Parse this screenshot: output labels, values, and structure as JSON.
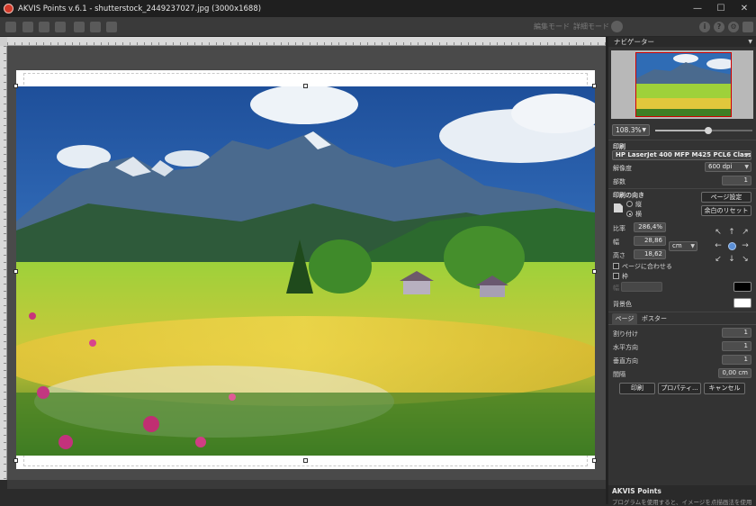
{
  "window": {
    "title": "AKVIS Points v.6.1 - shutterstock_2449237027.jpg (3000x1688)",
    "minimize": "—",
    "maximize": "☐",
    "close": "✕"
  },
  "toolbar": {
    "mode_edit": "編集モード",
    "mode_detail": "詳細モード",
    "icons": [
      "open-icon",
      "save-icon",
      "publish-icon",
      "print-icon",
      "before-icon",
      "after-icon",
      "share-icon",
      "info-icon",
      "help-icon",
      "settings-icon",
      "news-icon"
    ]
  },
  "navigator": {
    "header": "ナビゲーター",
    "zoom": "108.3%",
    "zoom_level": 0.55
  },
  "print": {
    "section_title": "印刷",
    "printer": "HP LaserJet 400 MFP M425 PCL6 Class D...",
    "resolution_label": "解像度",
    "resolution_value": "600 dpi",
    "copies_label": "部数",
    "copies_value": "1",
    "orientation_label": "印刷の向き",
    "portrait_label": "縦",
    "landscape_label": "横",
    "page_setup_button": "ページ設定",
    "reset_margins_button": "余白のリセット",
    "ratio_label": "比率",
    "ratio_value": "286,4%",
    "width_label": "幅",
    "width_value": "28,86",
    "height_label": "高さ",
    "height_value": "18,62",
    "unit_value": "cm",
    "fit_to_page_label": "ページに合わせる",
    "frame_label": "枠",
    "frame_width_label": "幅",
    "frame_color": "#000000",
    "background_label": "背景色",
    "background_color": "#ffffff"
  },
  "tabs": {
    "page": "ページ",
    "poster": "ポスター"
  },
  "poster": {
    "pages_label": "割り付け",
    "pages_value": "1",
    "horizontal_label": "水平方向",
    "horizontal_value": "1",
    "vertical_label": "垂直方向",
    "vertical_value": "1",
    "spacing_label": "間隔",
    "spacing_value": "0,00 cm"
  },
  "actions": {
    "print_button": "印刷",
    "properties_button": "プロパティ...",
    "cancel_button": "キャンセル"
  },
  "info": {
    "title": "AKVIS Points",
    "text": "プログラムを使用すると、イメージを点描画法を使用して..."
  },
  "colors": {
    "accent": "#5b8fd6",
    "panel_bg": "#333333"
  }
}
